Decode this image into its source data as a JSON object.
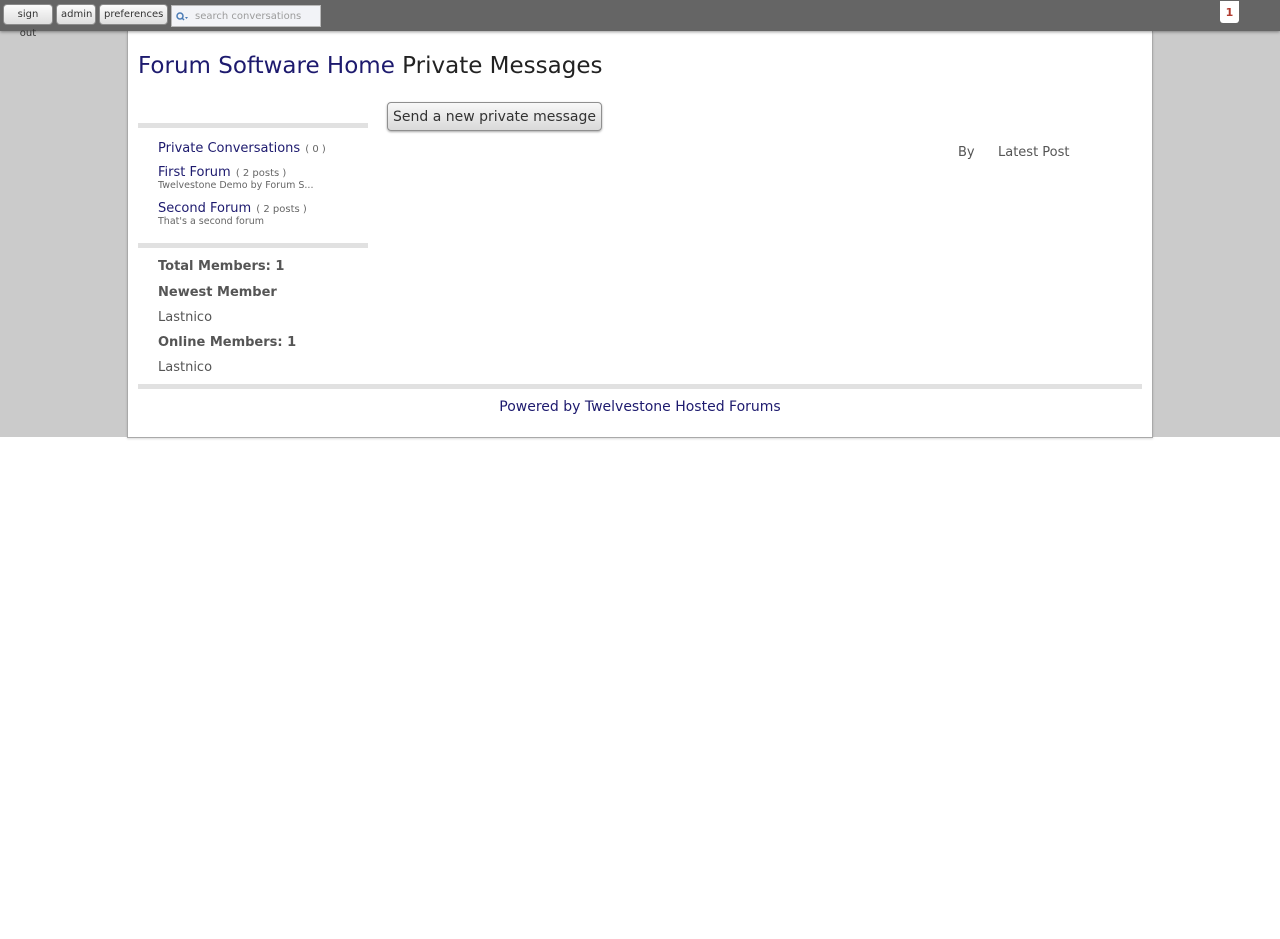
{
  "topbar": {
    "sign_out_label": "sign out",
    "admin_label": "admin",
    "preferences_label": "preferences",
    "search_placeholder": "search conversations",
    "notification_count": "1"
  },
  "page": {
    "home_link": "Forum Software Home",
    "title": "Private Messages"
  },
  "sidebar": {
    "private_conversations": {
      "label": "Private Conversations",
      "count": "( 0 )"
    },
    "forums": [
      {
        "label": "First Forum",
        "count": "( 2 posts )",
        "description": "Twelvestone Demo by Forum S..."
      },
      {
        "label": "Second Forum",
        "count": "( 2 posts )",
        "description": "That's a second forum"
      }
    ],
    "stats": {
      "total_members": "Total Members: 1",
      "newest_member_heading": "Newest Member",
      "newest_member": "Lastnico",
      "online_members": "Online Members: 1",
      "online_member": "Lastnico"
    }
  },
  "main": {
    "send_button_label": "Send a new private message",
    "columns": {
      "by": "By",
      "latest_post": "Latest Post"
    }
  },
  "footer": {
    "powered_by": "Powered by Twelvestone Hosted Forums"
  },
  "colors": {
    "topbar": "#656565",
    "background_band": "#cbcbcb",
    "link": "#1d1a6e",
    "badge_text": "#b03a2e"
  }
}
